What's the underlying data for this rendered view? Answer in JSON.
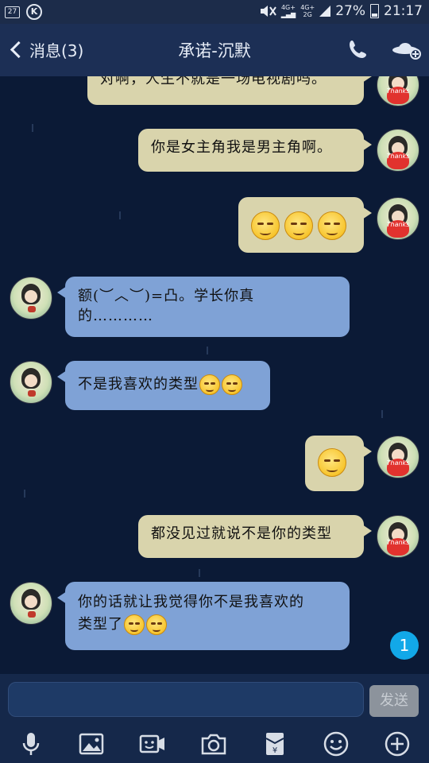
{
  "status_bar": {
    "notif_badge": "27",
    "k_icon": "K",
    "network_top": "4G+",
    "network_bottom": "2G",
    "battery": "27%",
    "time": "21:17"
  },
  "header": {
    "back_label": "消息(3)",
    "title": "承诺-沉默"
  },
  "messages": [
    {
      "side": "right",
      "text": "对啊，人生不就是一场电视剧吗。"
    },
    {
      "side": "right",
      "text": "你是女主角我是男主角啊。"
    },
    {
      "side": "right",
      "text": "",
      "emoji_count": 3
    },
    {
      "side": "left",
      "text_line1": "额(︶︿︶)=凸。学长你真",
      "text_line2": "的…………"
    },
    {
      "side": "left",
      "text": "不是我喜欢的类型"
    },
    {
      "side": "right",
      "text": "",
      "emoji_count": 1
    },
    {
      "side": "right",
      "text": "都没见过就说不是你的类型"
    },
    {
      "side": "left",
      "text_line1": "你的话就让我觉得你不是我喜欢的",
      "text_line2": "类型了"
    }
  ],
  "avatar": {
    "label": "Thanks"
  },
  "unread_count": "1",
  "composer": {
    "send_label": "发送"
  },
  "icons": [
    "mic-icon",
    "image-icon",
    "video-icon",
    "camera-icon",
    "red-packet-icon",
    "emoji-icon",
    "plus-icon"
  ]
}
